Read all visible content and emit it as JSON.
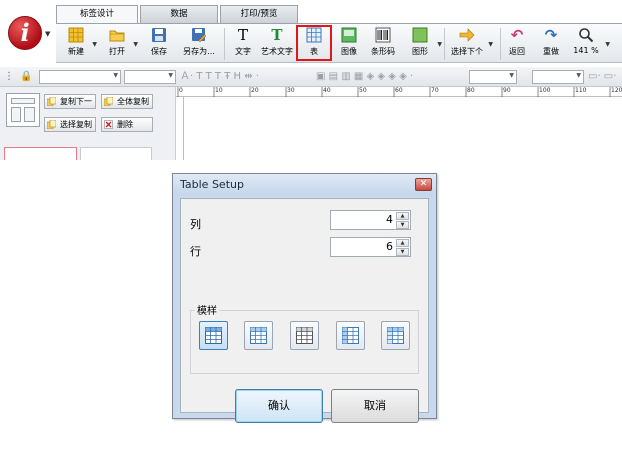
{
  "tabs": [
    "标签设计",
    "数据",
    "打印/预览"
  ],
  "ribbon": {
    "new": "新建",
    "open": "打开",
    "save": "保存",
    "save_as": "另存为...",
    "text": "文字",
    "art_text": "艺术文字",
    "table": "表",
    "image": "图像",
    "barcode": "条形码",
    "shape": "图形",
    "select_next": "选择下个",
    "undo": "返回",
    "redo": "重做",
    "zoom": "141 %"
  },
  "side_panel": {
    "copy_next": "复制下一",
    "copy_all": "全体复制",
    "select_copy": "选择复制",
    "delete": "删除"
  },
  "ruler_ticks": [
    "0",
    "10",
    "20",
    "30",
    "40",
    "50",
    "60",
    "70",
    "80",
    "90",
    "100",
    "110",
    "120"
  ],
  "dialog": {
    "title": "Table Setup",
    "columns_label": "列",
    "columns_value": "4",
    "rows_label": "行",
    "rows_value": "6",
    "template_group_label": "模样",
    "ok_label": "确认",
    "cancel_label": "取消"
  },
  "colors": {
    "logo_red": "#c1121f",
    "highlight_red": "#e21616",
    "dialog_frame": "#c9d9ec",
    "template_selected": "#3d7fbf"
  }
}
